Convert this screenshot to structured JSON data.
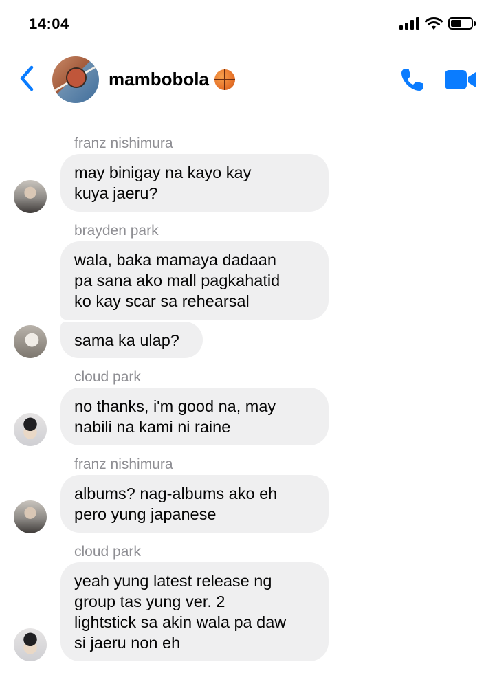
{
  "status_bar": {
    "time": "14:04"
  },
  "header": {
    "title": "mambobola",
    "title_emoji_icon": "basketball-icon",
    "accent_color": "#0a7cff"
  },
  "messages": [
    {
      "sender": "franz nishimura",
      "lines": [
        "may binigay na kayo kay",
        "kuya jaeru?"
      ]
    },
    {
      "sender": "brayden park",
      "lines": [
        "wala, baka mamaya dadaan",
        "pa sana ako mall pagkahatid",
        "ko kay scar sa rehearsal"
      ]
    },
    {
      "sender": "",
      "lines": [
        "sama ka ulap?"
      ]
    },
    {
      "sender": "cloud park",
      "lines": [
        "no thanks, i'm good na, may",
        "nabili na kami ni raine"
      ]
    },
    {
      "sender": "franz nishimura",
      "lines": [
        "albums? nag-albums ako eh",
        "pero yung japanese"
      ]
    },
    {
      "sender": "cloud park",
      "lines": [
        "yeah yung latest release ng",
        "group tas yung ver. 2",
        "lightstick sa akin wala pa daw",
        "si jaeru non eh"
      ]
    }
  ]
}
